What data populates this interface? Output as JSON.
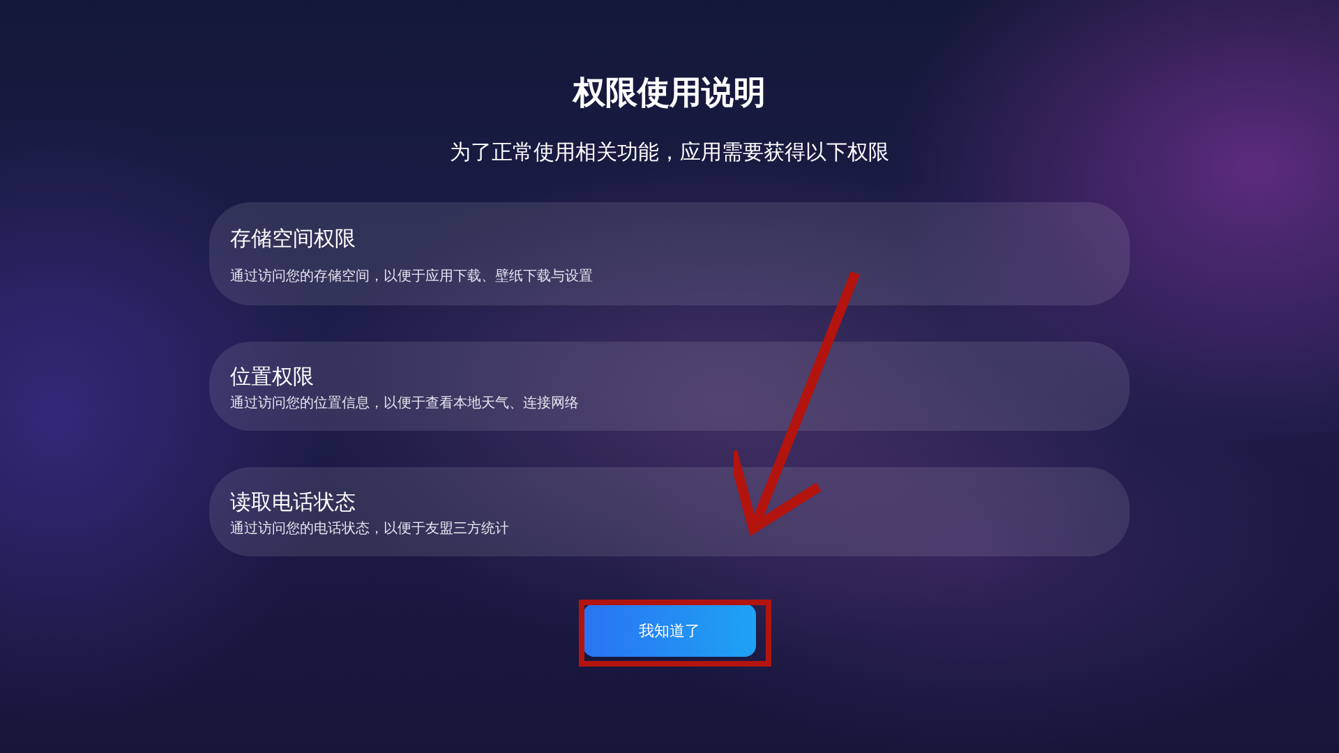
{
  "title": "权限使用说明",
  "subtitle": "为了正常使用相关功能，应用需要获得以下权限",
  "permissions": [
    {
      "name": "存储空间权限",
      "description": "通过访问您的存储空间，以便于应用下载、壁纸下载与设置",
      "kind": "tall"
    },
    {
      "name": "位置权限",
      "description": "通过访问您的位置信息，以便于查看本地天气、连接网络",
      "kind": "compact"
    },
    {
      "name": "读取电话状态",
      "description": "通过访问您的电话状态，以便于友盟三方统计",
      "kind": "compact"
    }
  ],
  "confirm_button": "我知道了"
}
